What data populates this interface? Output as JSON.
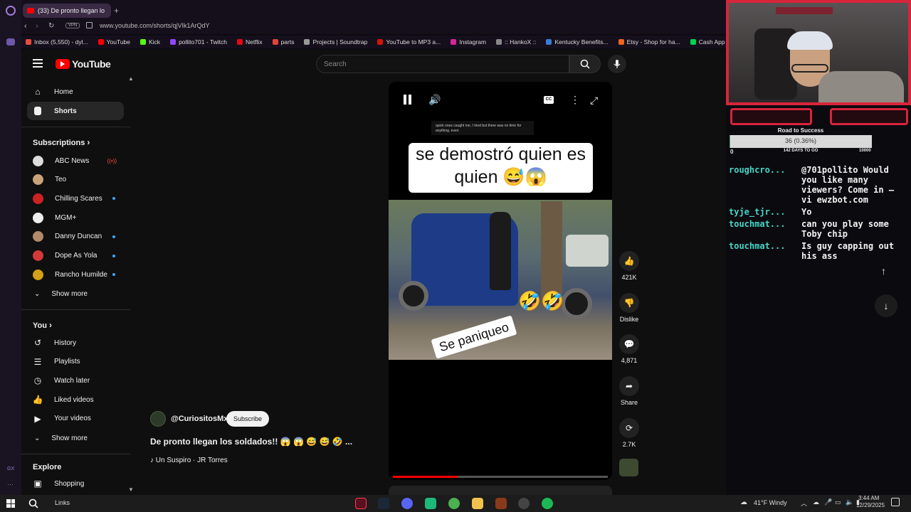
{
  "browser": {
    "tab_title": "(33) De pronto llegan lo",
    "address": "www.youtube.com/shorts/qjVIk1ArQdY",
    "vpn_label": "VPN",
    "bookmarks": [
      {
        "label": "Inbox (5,550) - dyl...",
        "color": "#e74c3c"
      },
      {
        "label": "YouTube",
        "color": "#ff0000"
      },
      {
        "label": "Kick",
        "color": "#53fc18"
      },
      {
        "label": "pollito701 - Twitch",
        "color": "#9146ff"
      },
      {
        "label": "Netflix",
        "color": "#e50914"
      },
      {
        "label": "parts",
        "color": "#e0443a"
      },
      {
        "label": "Projects | Soundtrap",
        "color": "#999999"
      },
      {
        "label": "YouTube to MP3 a...",
        "color": "#d3150b"
      },
      {
        "label": "Instagram",
        "color": "#d6249f"
      },
      {
        "label": ":: HankoX ::",
        "color": "#888888"
      },
      {
        "label": "Kentucky Benefits...",
        "color": "#3a7bd5"
      },
      {
        "label": "Etsy - Shop for ha...",
        "color": "#f1641e"
      },
      {
        "label": "Cash App",
        "color": "#00d64f"
      }
    ]
  },
  "youtube": {
    "logo": "YouTube",
    "search_placeholder": "Search",
    "nav": [
      {
        "label": "Home",
        "icon": "home-icon"
      },
      {
        "label": "Shorts",
        "icon": "shorts-icon"
      }
    ],
    "subscriptions_header": "Subscriptions",
    "subscriptions": [
      {
        "label": "ABC News",
        "color": "#dddddd",
        "live": true
      },
      {
        "label": "Teo",
        "color": "#c9a27a",
        "live": false
      },
      {
        "label": "Chilling Scares",
        "color": "#cc2222",
        "live": false,
        "dot": true
      },
      {
        "label": "MGM+",
        "color": "#eeeeee",
        "live": false
      },
      {
        "label": "Danny Duncan",
        "color": "#b08a6a",
        "live": false,
        "dot": true
      },
      {
        "label": "Dope As Yola",
        "color": "#d23a3a",
        "live": false,
        "dot": true
      },
      {
        "label": "Rancho Humilde",
        "color": "#d4a017",
        "live": false,
        "dot": true
      }
    ],
    "show_more_1": "Show more",
    "you_header": "You",
    "you_items": [
      {
        "label": "History",
        "icon": "history-icon"
      },
      {
        "label": "Playlists",
        "icon": "playlists-icon"
      },
      {
        "label": "Watch later",
        "icon": "watch-later-icon"
      },
      {
        "label": "Liked videos",
        "icon": "liked-videos-icon"
      },
      {
        "label": "Your videos",
        "icon": "your-videos-icon"
      }
    ],
    "show_more_2": "Show more",
    "explore_header": "Explore",
    "explore_items": [
      {
        "label": "Shopping",
        "icon": "shopping-icon"
      }
    ]
  },
  "short": {
    "title_card": "se demostró quien es quien 😅😱",
    "caption_small": "quick ones caught me, I tried but there was no time for anything. even",
    "sticker": "Se paniqueo",
    "emoji_overlay": "🤣🤣",
    "channel": "@CuriositosMx",
    "subscribe_label": "Subscribe",
    "video_title": "De pronto llegan los soldados!! 😱 😱 😅 😅 🤣 ...",
    "audio": "Un Suspiro · JR Torres",
    "actions": [
      {
        "label": "421K",
        "icon": "like-icon"
      },
      {
        "label": "Dislike",
        "icon": "dislike-icon"
      },
      {
        "label": "4,871",
        "icon": "comments-icon"
      },
      {
        "label": "Share",
        "icon": "share-icon"
      },
      {
        "label": "2.7K",
        "icon": "remix-icon"
      }
    ],
    "progress": 0.3
  },
  "overlay": {
    "goal_title": "Road to Success",
    "goal_value": "36 (0.36%)",
    "goal_min": "0",
    "goal_days": "142 DAYS TO GO",
    "goal_max": "10000",
    "goal_fraction": 0.0036,
    "chat": [
      {
        "user": "roughcro...",
        "msg": "@701pollito Would you like many viewers? Come in — vi ewzbot.com"
      },
      {
        "user": "tyje_tjr...",
        "msg": "Yo"
      },
      {
        "user": "touchmat...",
        "msg": "can you play some Toby chip"
      },
      {
        "user": "touchmat...",
        "msg": "Is guy capping out his ass"
      }
    ]
  },
  "taskbar": {
    "links_label": "Links",
    "weather": "41°F  Windy",
    "time": "3:44 AM",
    "date": "12/29/2025"
  }
}
